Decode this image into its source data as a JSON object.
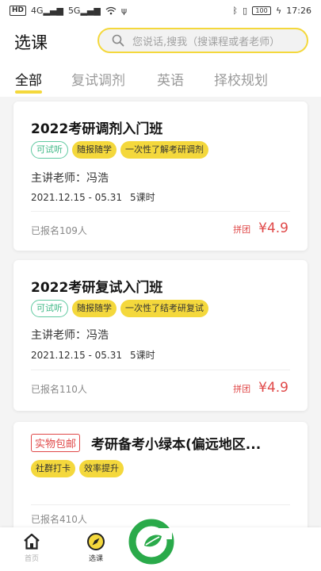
{
  "status_bar": {
    "left_tag": "HD",
    "signal_1": "4G",
    "signal_2": "5G",
    "right_tag": "100",
    "time": "17:26"
  },
  "header": {
    "title": "选课",
    "search_placeholder": "您说话,搜我（搜课程或者老师）"
  },
  "tabs": [
    {
      "label": "全部",
      "active": true
    },
    {
      "label": "复试调剂",
      "active": false
    },
    {
      "label": "英语",
      "active": false
    },
    {
      "label": "择校规划",
      "active": false
    }
  ],
  "courses": [
    {
      "title": "2022考研调剂入门班",
      "tags": [
        "可试听",
        "随报随学",
        "一次性了解考研调剂"
      ],
      "teacher": "主讲老师：冯浩",
      "date_range": "2021.12.15 - 05.31",
      "lessons": "5课时",
      "enrolled": "已报名109人",
      "group_label": "拼团",
      "price": "¥4.9"
    },
    {
      "title": "2022考研复试入门班",
      "tags": [
        "可试听",
        "随报随学",
        "一次性了结考研复试"
      ],
      "teacher": "主讲老师：冯浩",
      "date_range": "2021.12.15 - 05.31",
      "lessons": "5课时",
      "enrolled": "已报名110人",
      "group_label": "拼团",
      "price": "¥4.9"
    },
    {
      "badge": "实物包邮",
      "title": "考研备考小绿本(偏远地区...",
      "tags": [
        "社群打卡",
        "效率提升"
      ],
      "enrolled": "已报名410人"
    }
  ],
  "bottom_nav": [
    {
      "label": "首页",
      "icon": "home-icon"
    },
    {
      "label": "选课",
      "icon": "compass-icon"
    }
  ],
  "colors": {
    "accent_yellow": "#f4d83c",
    "price_red": "#e04848",
    "trial_green": "#3fb886"
  }
}
